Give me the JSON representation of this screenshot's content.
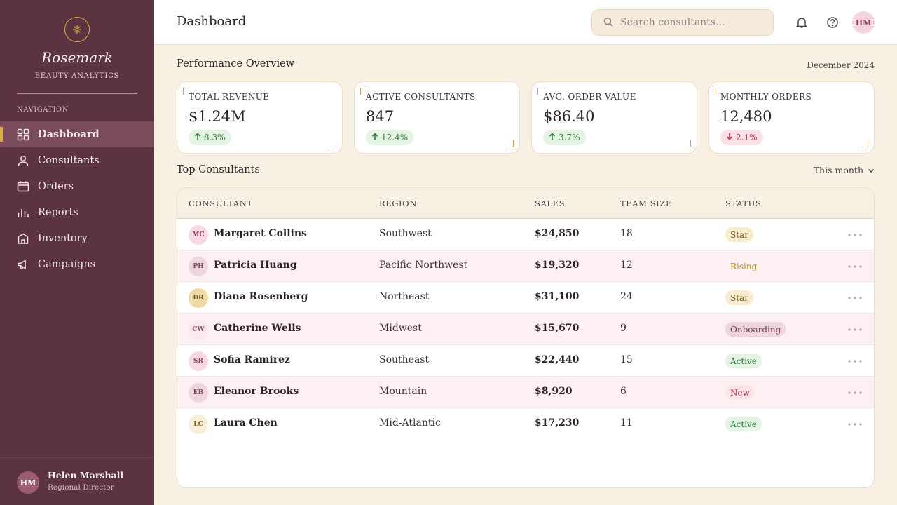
{
  "colors": {
    "sidebar": "#5c3340",
    "accent_gold": "#d9ad3c",
    "background": "#f7f0e3",
    "up": "#2e7d3e",
    "down": "#c0304e"
  },
  "sidebar": {
    "brand": "Rosemark",
    "subtitle": "BEAUTY ANALYTICS",
    "nav_heading": "NAVIGATION",
    "items": [
      {
        "label": "Dashboard",
        "icon": "grid-icon",
        "active": true
      },
      {
        "label": "Consultants",
        "icon": "user-icon"
      },
      {
        "label": "Orders",
        "icon": "calendar-icon"
      },
      {
        "label": "Reports",
        "icon": "bar-chart-icon"
      },
      {
        "label": "Inventory",
        "icon": "box-icon"
      },
      {
        "label": "Campaigns",
        "icon": "megaphone-icon"
      }
    ],
    "user": {
      "initials": "HM",
      "name": "Helen Marshall",
      "role": "Regional Director"
    }
  },
  "header": {
    "title": "Dashboard",
    "search_placeholder": "Search consultants...",
    "avatar_initials": "HM"
  },
  "overview": {
    "title": "Performance Overview",
    "period": "December 2024",
    "kpis": [
      {
        "label": "TOTAL REVENUE",
        "value": "$1.24M",
        "change": "8.3%",
        "direction": "up"
      },
      {
        "label": "ACTIVE CONSULTANTS",
        "value": "847",
        "change": "12.4%",
        "direction": "up"
      },
      {
        "label": "AVG. ORDER VALUE",
        "value": "$86.40",
        "change": "3.7%",
        "direction": "up"
      },
      {
        "label": "MONTHLY ORDERS",
        "value": "12,480",
        "change": "2.1%",
        "direction": "down"
      }
    ]
  },
  "consultants": {
    "title": "Top Consultants",
    "range": "This month",
    "columns": [
      "CONSULTANT",
      "REGION",
      "SALES",
      "TEAM SIZE",
      "STATUS"
    ],
    "rows": [
      {
        "initials": "MC",
        "name": "Margaret Collins",
        "region": "Southwest",
        "sales": "$24,850",
        "team": "18",
        "status": "Star"
      },
      {
        "initials": "PH",
        "name": "Patricia Huang",
        "region": "Pacific Northwest",
        "sales": "$19,320",
        "team": "12",
        "status": "Rising"
      },
      {
        "initials": "DR",
        "name": "Diana Rosenberg",
        "region": "Northeast",
        "sales": "$31,100",
        "team": "24",
        "status": "Star"
      },
      {
        "initials": "CW",
        "name": "Catherine Wells",
        "region": "Midwest",
        "sales": "$15,670",
        "team": "9",
        "status": "Onboarding"
      },
      {
        "initials": "SR",
        "name": "Sofia Ramirez",
        "region": "Southeast",
        "sales": "$22,440",
        "team": "15",
        "status": "Active"
      },
      {
        "initials": "EB",
        "name": "Eleanor Brooks",
        "region": "Mountain",
        "sales": "$8,920",
        "team": "6",
        "status": "New"
      },
      {
        "initials": "LC",
        "name": "Laura Chen",
        "region": "Mid-Atlantic",
        "sales": "$17,230",
        "team": "11",
        "status": "Active"
      }
    ]
  }
}
